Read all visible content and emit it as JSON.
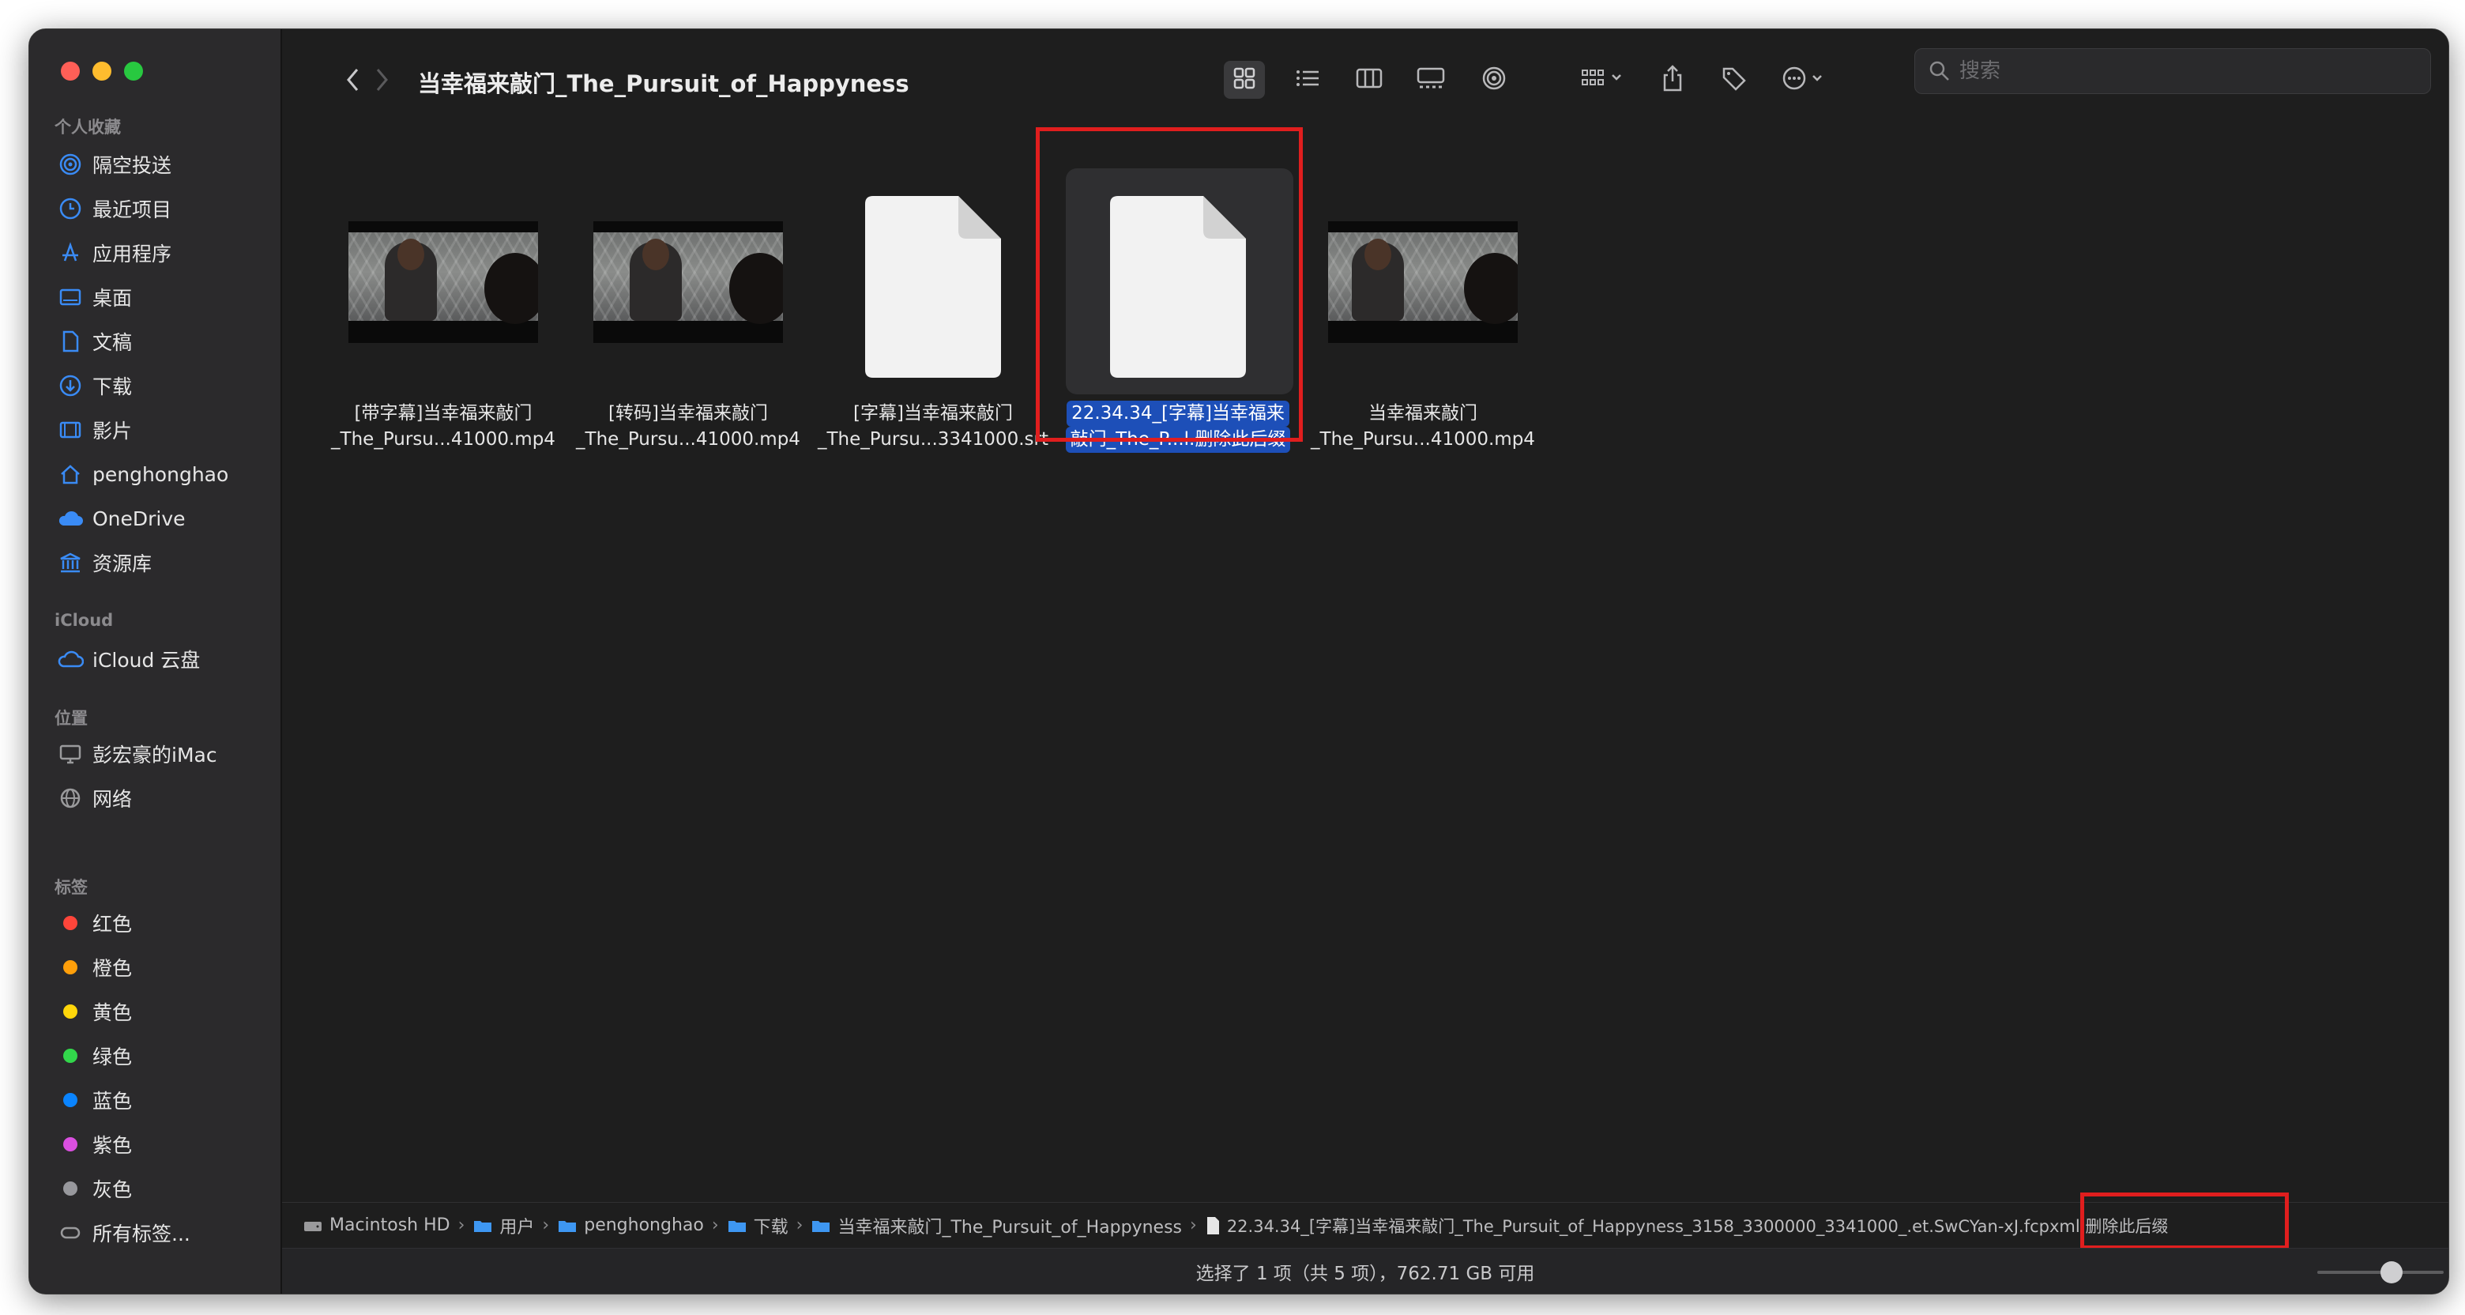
{
  "window": {
    "title": "当幸福来敲门_The_Pursuit_of_Happyness"
  },
  "sidebar": {
    "sections": [
      {
        "title": "个人收藏",
        "items": [
          {
            "label": "隔空投送",
            "icon": "airdrop-icon"
          },
          {
            "label": "最近项目",
            "icon": "clock-icon"
          },
          {
            "label": "应用程序",
            "icon": "applications-icon"
          },
          {
            "label": "桌面",
            "icon": "desktop-icon"
          },
          {
            "label": "文稿",
            "icon": "document-icon"
          },
          {
            "label": "下载",
            "icon": "download-icon"
          },
          {
            "label": "影片",
            "icon": "film-icon"
          },
          {
            "label": "penghonghao",
            "icon": "home-icon"
          },
          {
            "label": "OneDrive",
            "icon": "cloud-icon"
          },
          {
            "label": "资源库",
            "icon": "library-icon"
          }
        ]
      },
      {
        "title": "iCloud",
        "items": [
          {
            "label": "iCloud 云盘",
            "icon": "icloud-icon"
          }
        ]
      },
      {
        "title": "位置",
        "items": [
          {
            "label": "彭宏豪的iMac",
            "icon": "imac-icon"
          },
          {
            "label": "网络",
            "icon": "network-icon"
          }
        ]
      },
      {
        "title": "标签",
        "items": [
          {
            "label": "红色",
            "color": "#ff453a"
          },
          {
            "label": "橙色",
            "color": "#ff9f0a"
          },
          {
            "label": "黄色",
            "color": "#ffd60a"
          },
          {
            "label": "绿色",
            "color": "#32d74b"
          },
          {
            "label": "蓝色",
            "color": "#0a84ff"
          },
          {
            "label": "紫色",
            "color": "#da4fe0"
          },
          {
            "label": "灰色",
            "color": "#98989d"
          },
          {
            "label": "所有标签...",
            "icon": "all-tags-icon"
          }
        ]
      }
    ]
  },
  "toolbar": {
    "search_placeholder": "搜索"
  },
  "files": [
    {
      "line1": "[带字幕]当幸福来敲门",
      "line2": "_The_Pursu...41000.mp4",
      "kind": "video"
    },
    {
      "line1": "[转码]当幸福来敲门",
      "line2": "_The_Pursu...41000.mp4",
      "kind": "video"
    },
    {
      "line1": "[字幕]当幸福来敲门",
      "line2": "_The_Pursu...3341000.srt",
      "kind": "document"
    },
    {
      "line1": "22.34.34_[字幕]当幸福来",
      "line2": "敲门_The_P...l.删除此后缀",
      "kind": "document",
      "selected": true
    },
    {
      "line1": "当幸福来敲门",
      "line2": "_The_Pursu...41000.mp4",
      "kind": "video"
    }
  ],
  "pathbar": [
    {
      "label": "Macintosh HD",
      "icon": "disk-icon"
    },
    {
      "label": "用户",
      "icon": "folder-icon"
    },
    {
      "label": "penghonghao",
      "icon": "folder-icon"
    },
    {
      "label": "下载",
      "icon": "folder-icon"
    },
    {
      "label": "当幸福来敲门_The_Pursuit_of_Happyness",
      "icon": "folder-icon"
    },
    {
      "label": "22.34.34_[字幕]当幸福来敲门_The_Pursuit_of_Happyness_3158_3300000_3341000_.et.SwCYan-xJ.fcpxml.删除此后缀",
      "icon": "file-icon"
    }
  ],
  "status": {
    "text": "选择了 1 项（共 5 项），762.71 GB 可用"
  },
  "colors": {
    "highlight": "#1d4fb8",
    "annotation": "#e01e1e"
  }
}
